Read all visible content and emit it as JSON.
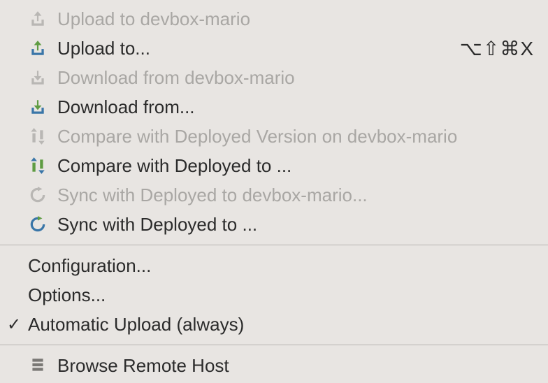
{
  "menu": {
    "upload_to_host": "Upload to devbox-mario",
    "upload_to": "Upload to...",
    "upload_to_shortcut": "⌥⇧⌘X",
    "download_from_host": "Download from devbox-mario",
    "download_from": "Download from...",
    "compare_host": "Compare with Deployed Version on devbox-mario",
    "compare_to": "Compare with Deployed to ...",
    "sync_host": "Sync with Deployed to devbox-mario...",
    "sync_to": "Sync with Deployed to ...",
    "configuration": "Configuration...",
    "options": "Options...",
    "auto_upload": "Automatic Upload (always)",
    "browse_remote": "Browse Remote Host"
  },
  "state": {
    "auto_upload_checked": true
  }
}
